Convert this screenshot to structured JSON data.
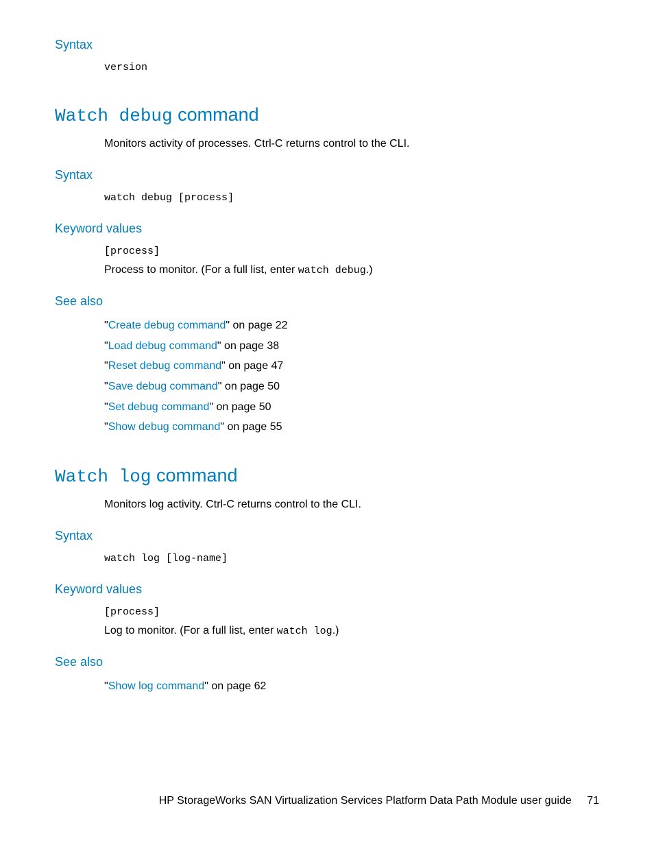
{
  "s1": {
    "syntax_label": "Syntax",
    "syntax_code": "version"
  },
  "s2": {
    "title_mono": "Watch debug",
    "title_plain": " command",
    "desc": "Monitors activity of processes. Ctrl-C returns control to the CLI.",
    "syntax_label": "Syntax",
    "syntax_code": "watch debug [process]",
    "kv_label": "Keyword values",
    "kv_code": "[process]",
    "kv_desc_pre": "Process to monitor. (For a full list, enter ",
    "kv_desc_code": "watch debug",
    "kv_desc_post": ".)",
    "seealso_label": "See also",
    "refs": [
      {
        "link": "Create debug command",
        "tail": "\" on page 22"
      },
      {
        "link": "Load debug command",
        "tail": "\" on page 38"
      },
      {
        "link": "Reset debug command",
        "tail": "\" on page 47"
      },
      {
        "link": "Save debug command",
        "tail": "\" on page 50"
      },
      {
        "link": "Set debug command",
        "tail": "\" on page 50"
      },
      {
        "link": "Show debug command",
        "tail": "\" on page 55"
      }
    ]
  },
  "s3": {
    "title_mono": "Watch log",
    "title_plain": " command",
    "desc": "Monitors log activity. Ctrl-C returns control to the CLI.",
    "syntax_label": "Syntax",
    "syntax_code": "watch log [log-name]",
    "kv_label": "Keyword values",
    "kv_code": "[process]",
    "kv_desc_pre": "Log to monitor. (For a full list, enter ",
    "kv_desc_code": "watch log",
    "kv_desc_post": ".)",
    "seealso_label": "See also",
    "refs": [
      {
        "link": "Show log command",
        "tail": "\" on page 62"
      }
    ]
  },
  "footer": {
    "text": "HP StorageWorks SAN Virtualization Services Platform Data Path Module user guide",
    "page": "71"
  }
}
